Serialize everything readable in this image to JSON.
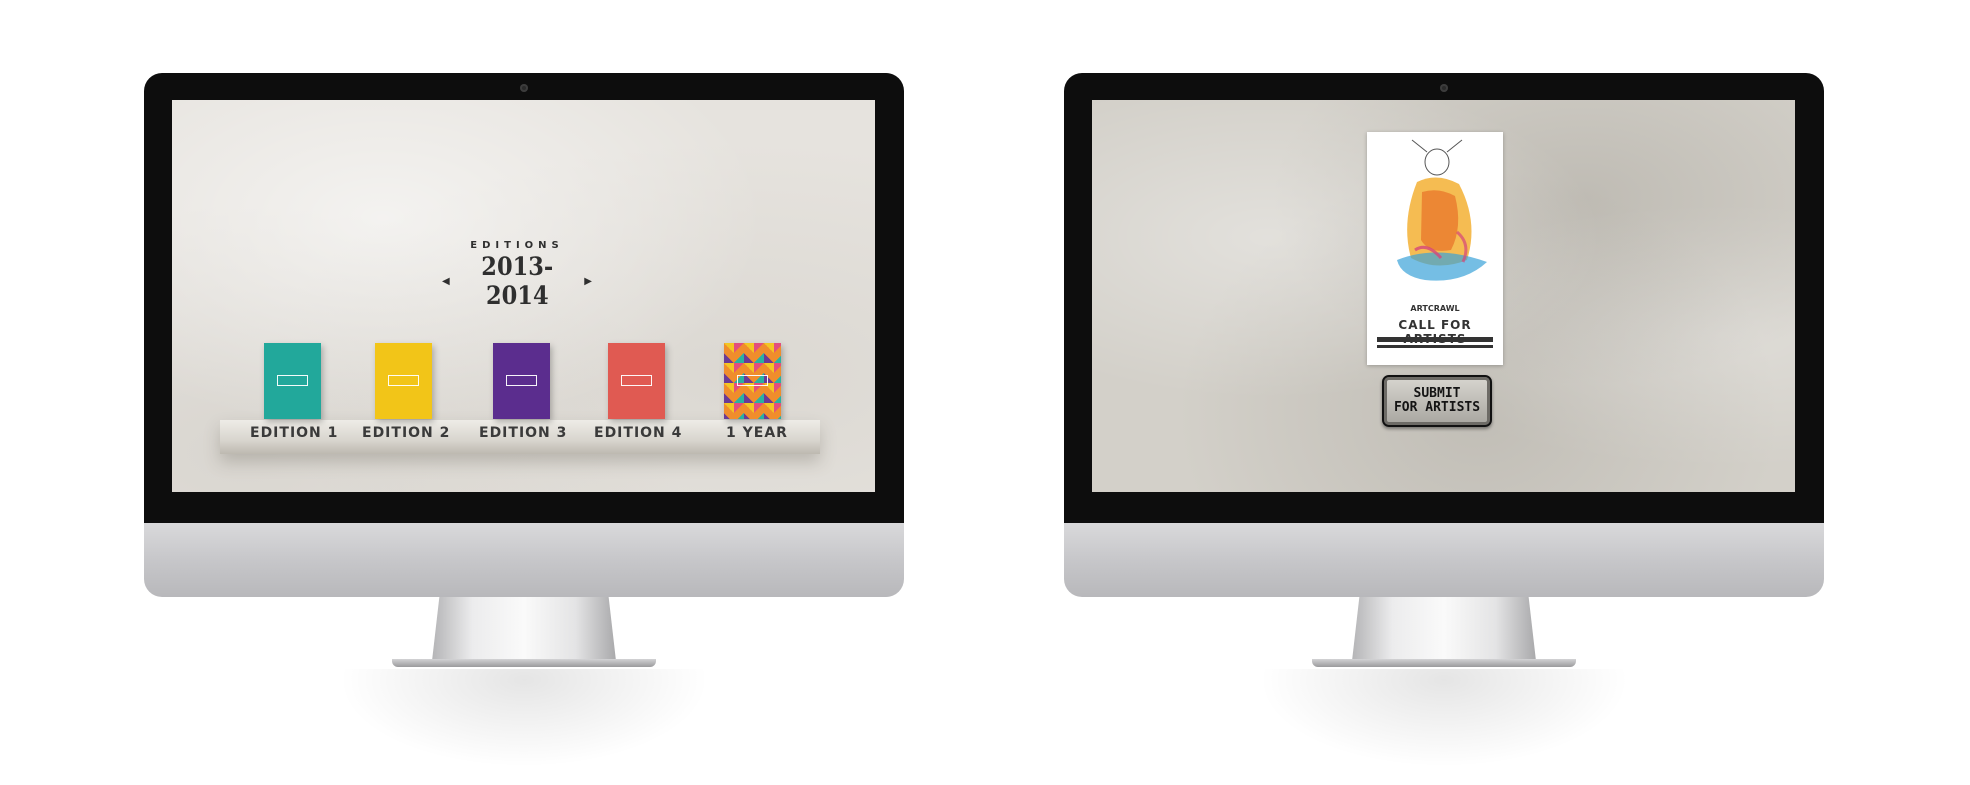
{
  "left_screen": {
    "heading": {
      "label": "EDITIONS",
      "years": "2013-2014",
      "prev_arrow": "◆",
      "next_arrow": "◆"
    },
    "books": [
      {
        "label": "EDITION 1",
        "color": "#22a89b"
      },
      {
        "label": "EDITION 2",
        "color": "#f2c518"
      },
      {
        "label": "EDITION 3",
        "color": "#5b2d8e"
      },
      {
        "label": "EDITION 4",
        "color": "#e05a52"
      },
      {
        "label": "1 YEAR",
        "color": "pattern"
      }
    ]
  },
  "right_screen": {
    "poster": {
      "brand": "ARTCRAWL",
      "title": "CALL FOR ARTISTS"
    },
    "submit_button": {
      "label": "SUBMIT\nFOR ARTISTS"
    }
  },
  "icons": {
    "prev": "caret-left-icon",
    "next": "caret-right-icon",
    "camera": "camera-icon"
  }
}
